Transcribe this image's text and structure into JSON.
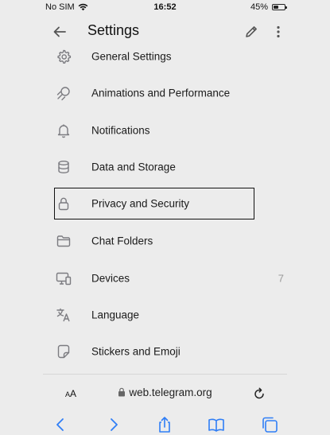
{
  "status_bar": {
    "carrier": "No SIM",
    "time": "16:52",
    "battery_percent": "45%",
    "battery_level": 0.45
  },
  "header": {
    "title": "Settings"
  },
  "settings": {
    "items": [
      {
        "label": "General Settings",
        "icon": "gear-icon"
      },
      {
        "label": "Animations and Performance",
        "icon": "animation-icon"
      },
      {
        "label": "Notifications",
        "icon": "bell-icon"
      },
      {
        "label": "Data and Storage",
        "icon": "database-icon"
      },
      {
        "label": "Privacy and Security",
        "icon": "lock-icon",
        "highlighted": true
      },
      {
        "label": "Chat Folders",
        "icon": "folder-icon"
      },
      {
        "label": "Devices",
        "icon": "devices-icon",
        "badge": "7"
      },
      {
        "label": "Language",
        "icon": "language-icon"
      },
      {
        "label": "Stickers and Emoji",
        "icon": "sticker-icon"
      }
    ]
  },
  "browser": {
    "aa_label_small": "A",
    "aa_label_large": "A",
    "url": "web.telegram.org"
  },
  "colors": {
    "accent": "#2f7ef6",
    "icon_gray": "#7b7b80",
    "background": "#ececec"
  }
}
